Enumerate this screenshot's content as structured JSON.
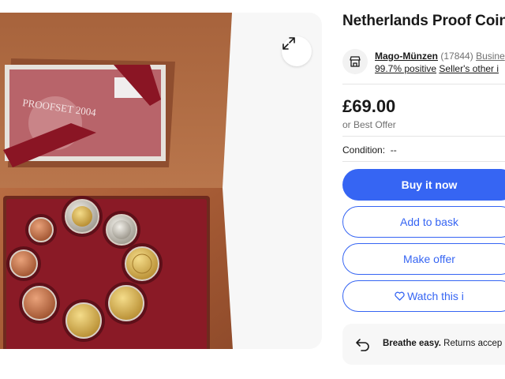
{
  "gallery": {
    "expand_icon": "expand-arrows-icon",
    "box_card_title": "PROOFSET 2004"
  },
  "title": "Netherlands Proof Coin",
  "seller": {
    "icon": "store-icon",
    "name": "Mago-Münzen",
    "count": "(17844)",
    "type": "Busine",
    "positive": "99.7% positive",
    "other": "Seller's other i"
  },
  "price": {
    "amount": "£69.00",
    "best_offer": "or Best Offer"
  },
  "condition": {
    "label": "Condition:",
    "value": "--"
  },
  "buttons": {
    "buy": "Buy it now",
    "basket": "Add to bask",
    "offer": "Make offer",
    "watch": "Watch this i"
  },
  "breathe": {
    "icon": "returns-arrow-icon",
    "bold": "Breathe easy.",
    "text": "Returns accep"
  },
  "colors": {
    "accent": "#3665f3",
    "wood": "#a85f3a",
    "velvet": "#8a1a26"
  }
}
